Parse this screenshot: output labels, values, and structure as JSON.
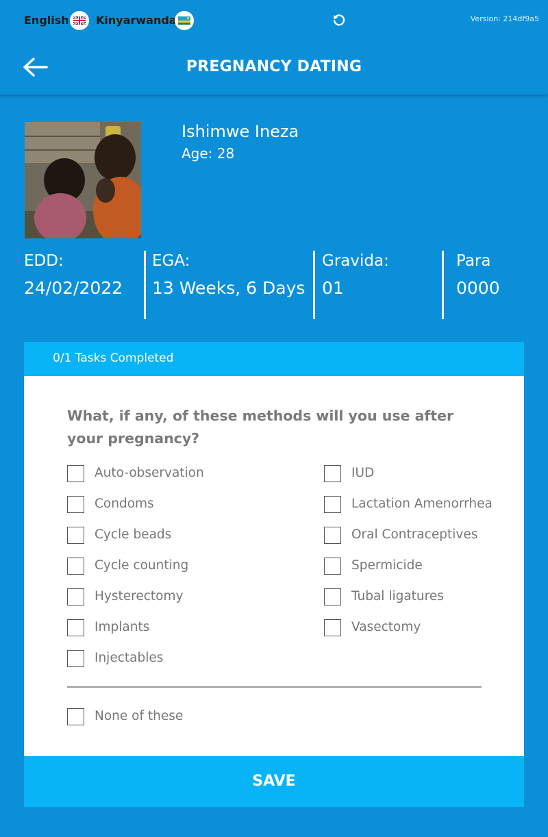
{
  "topbar": {
    "lang_english": "English",
    "lang_kinyarwanda": "Kinyarwanda",
    "version": "Version: 214df9a5",
    "icons": {
      "uk_flag": "uk-flag-icon",
      "rw_flag": "rwanda-flag-icon",
      "refresh": "refresh-icon"
    }
  },
  "header": {
    "title": "PREGNANCY DATING",
    "back_icon": "arrow-left-icon"
  },
  "patient": {
    "name": "Ishimwe Ineza",
    "age": "Age: 28"
  },
  "stats": [
    {
      "label": "EDD:",
      "value": "24/02/2022"
    },
    {
      "label": "EGA:",
      "value": "13 Weeks, 6 Days"
    },
    {
      "label": "Gravida:",
      "value": "01"
    },
    {
      "label": "Para",
      "value": "0000"
    }
  ],
  "card": {
    "tasks": "0/1 Tasks Completed",
    "question": "What, if any, of these methods will you use after your pregnancy?",
    "options_left": [
      "Auto-observation",
      "Condoms",
      "Cycle beads",
      "Cycle counting",
      "Hysterectomy",
      "Implants",
      "Injectables"
    ],
    "options_right": [
      "IUD",
      "Lactation Amenorrhea",
      "Oral Contraceptives",
      "Spermicide",
      "Tubal ligatures",
      "Vasectomy"
    ],
    "none_option": "None of these",
    "save": "SAVE"
  },
  "colors": {
    "background": "#0b8fd9",
    "accent": "#08b4f5",
    "card": "#ffffff",
    "option_text": "#777777"
  }
}
